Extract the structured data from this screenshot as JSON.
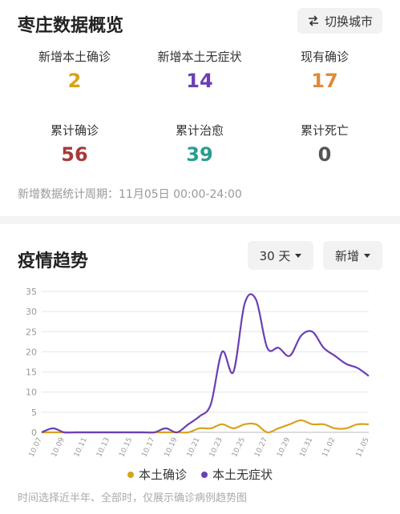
{
  "overview": {
    "title": "枣庄数据概览",
    "switch_label": "切换城市",
    "stats": [
      {
        "label": "新增本土确诊",
        "value": "2",
        "color": "#d9a21b"
      },
      {
        "label": "新增本土无症状",
        "value": "14",
        "color": "#6b3fb3"
      },
      {
        "label": "现有确诊",
        "value": "17",
        "color": "#e08a3a"
      },
      {
        "label": "累计确诊",
        "value": "56",
        "color": "#a63a3a"
      },
      {
        "label": "累计治愈",
        "value": "39",
        "color": "#2a9d8f"
      },
      {
        "label": "累计死亡",
        "value": "0",
        "color": "#555555"
      }
    ],
    "period": "新增数据统计周期：11月05日 00:00-24:00"
  },
  "trend": {
    "title": "疫情趋势",
    "range_label": "30 天",
    "mode_label": "新增",
    "note": "时间选择近半年、全部时，仅展示确诊病例趋势图"
  },
  "chart_data": {
    "type": "line",
    "x": [
      "10.07",
      "10.08",
      "10.09",
      "10.10",
      "10.11",
      "10.12",
      "10.13",
      "10.14",
      "10.15",
      "10.16",
      "10.17",
      "10.18",
      "10.19",
      "10.20",
      "10.21",
      "10.22",
      "10.23",
      "10.24",
      "10.25",
      "10.26",
      "10.27",
      "10.28",
      "10.29",
      "10.30",
      "10.31",
      "11.01",
      "11.02",
      "11.03",
      "11.04",
      "11.05"
    ],
    "tick_labels": [
      "10.07",
      "10.09",
      "10.11",
      "10.13",
      "10.15",
      "10.17",
      "10.19",
      "10.21",
      "10.23",
      "10.25",
      "10.27",
      "10.29",
      "10.31",
      "11.02",
      "11.05"
    ],
    "ylim": [
      0,
      35
    ],
    "yticks": [
      0,
      5,
      10,
      15,
      20,
      25,
      30,
      35
    ],
    "grid": true,
    "legend_position": "bottom",
    "series": [
      {
        "name": "本土确诊",
        "color": "#d9a21b",
        "values": [
          0,
          0,
          0,
          0,
          0,
          0,
          0,
          0,
          0,
          0,
          0,
          0,
          0,
          0,
          1,
          1,
          2,
          1,
          2,
          2,
          0,
          1,
          2,
          3,
          2,
          2,
          1,
          1,
          2,
          2
        ]
      },
      {
        "name": "本土无症状",
        "color": "#6b3fb3",
        "values": [
          0,
          1,
          0,
          0,
          0,
          0,
          0,
          0,
          0,
          0,
          0,
          1,
          0,
          2,
          4,
          7,
          20,
          15,
          32,
          33,
          21,
          21,
          19,
          24,
          25,
          21,
          19,
          17,
          16,
          14
        ]
      }
    ]
  }
}
